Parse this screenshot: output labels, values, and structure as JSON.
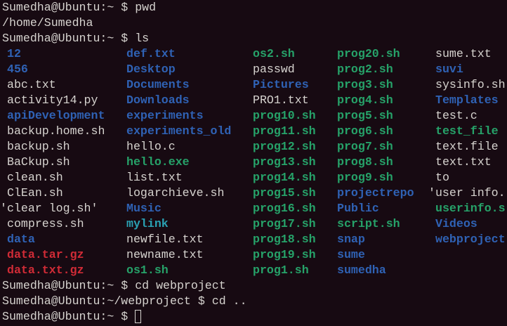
{
  "colors": {
    "background": "#170a12",
    "text": "#d6d3cf",
    "directory": "#2f62b5",
    "executable": "#26a269",
    "archive": "#d02b36",
    "symlink": "#2aa1b3"
  },
  "commands": [
    {
      "prompt": "Sumedha@Ubuntu:~ $ ",
      "command": "pwd"
    },
    {
      "output": "/home/Sumedha"
    },
    {
      "prompt": "Sumedha@Ubuntu:~ $ ",
      "command": "ls"
    }
  ],
  "ls_rows": [
    [
      {
        "t": "12",
        "k": "dir"
      },
      {
        "t": "def.txt",
        "k": "dir"
      },
      {
        "t": "os2.sh",
        "k": "exec"
      },
      {
        "t": "prog20.sh",
        "k": "exec"
      },
      {
        "t": "sume.txt",
        "k": "file"
      }
    ],
    [
      {
        "t": "456",
        "k": "dir"
      },
      {
        "t": "Desktop",
        "k": "dir"
      },
      {
        "t": "passwd",
        "k": "file"
      },
      {
        "t": "prog2.sh",
        "k": "exec"
      },
      {
        "t": "suvi",
        "k": "dir"
      }
    ],
    [
      {
        "t": "abc.txt",
        "k": "file"
      },
      {
        "t": "Documents",
        "k": "dir"
      },
      {
        "t": "Pictures",
        "k": "dir"
      },
      {
        "t": "prog3.sh",
        "k": "exec"
      },
      {
        "t": "sysinfo.sh",
        "k": "file"
      }
    ],
    [
      {
        "t": "activity14.py",
        "k": "file"
      },
      {
        "t": "Downloads",
        "k": "dir"
      },
      {
        "t": "PRO1.txt",
        "k": "file"
      },
      {
        "t": "prog4.sh",
        "k": "exec"
      },
      {
        "t": "Templates",
        "k": "dir"
      }
    ],
    [
      {
        "t": "apiDevelopment",
        "k": "dir"
      },
      {
        "t": "experiments",
        "k": "dir"
      },
      {
        "t": "prog10.sh",
        "k": "exec"
      },
      {
        "t": "prog5.sh",
        "k": "exec"
      },
      {
        "t": "test.c",
        "k": "file"
      }
    ],
    [
      {
        "t": "backup.home.sh",
        "k": "file"
      },
      {
        "t": "experiments_old",
        "k": "dir"
      },
      {
        "t": "prog11.sh",
        "k": "exec"
      },
      {
        "t": "prog6.sh",
        "k": "exec"
      },
      {
        "t": "test_file",
        "k": "exec"
      }
    ],
    [
      {
        "t": "backup.sh",
        "k": "file"
      },
      {
        "t": "hello.c",
        "k": "file"
      },
      {
        "t": "prog12.sh",
        "k": "exec"
      },
      {
        "t": "prog7.sh",
        "k": "exec"
      },
      {
        "t": "text.file",
        "k": "file"
      }
    ],
    [
      {
        "t": "BaCkup.sh",
        "k": "file"
      },
      {
        "t": "hello.exe",
        "k": "exec"
      },
      {
        "t": "prog13.sh",
        "k": "exec"
      },
      {
        "t": "prog8.sh",
        "k": "exec"
      },
      {
        "t": "text.txt",
        "k": "file"
      }
    ],
    [
      {
        "t": "clean.sh",
        "k": "file"
      },
      {
        "t": "list.txt",
        "k": "file"
      },
      {
        "t": "prog14.sh",
        "k": "exec"
      },
      {
        "t": "prog9.sh",
        "k": "exec"
      },
      {
        "t": "to",
        "k": "file"
      }
    ],
    [
      {
        "t": "ClEan.sh",
        "k": "file"
      },
      {
        "t": "logarchieve.sh",
        "k": "file"
      },
      {
        "t": "prog15.sh",
        "k": "exec"
      },
      {
        "t": "projectrepo",
        "k": "dir"
      },
      {
        "t": "'user info.",
        "k": "file",
        "q": 1
      }
    ],
    [
      {
        "t": "'clear log.sh'",
        "k": "file",
        "q": 1
      },
      {
        "t": "Music",
        "k": "dir"
      },
      {
        "t": "prog16.sh",
        "k": "exec"
      },
      {
        "t": "Public",
        "k": "dir"
      },
      {
        "t": "userinfo.s",
        "k": "exec"
      }
    ],
    [
      {
        "t": "compress.sh",
        "k": "file"
      },
      {
        "t": "mylink",
        "k": "link"
      },
      {
        "t": "prog17.sh",
        "k": "exec"
      },
      {
        "t": "script.sh",
        "k": "exec"
      },
      {
        "t": "Videos",
        "k": "dir"
      }
    ],
    [
      {
        "t": "data",
        "k": "dir"
      },
      {
        "t": "newfile.txt",
        "k": "file"
      },
      {
        "t": "prog18.sh",
        "k": "exec"
      },
      {
        "t": "snap",
        "k": "dir"
      },
      {
        "t": "webproject",
        "k": "dir"
      }
    ],
    [
      {
        "t": "data.tar.gz",
        "k": "archive"
      },
      {
        "t": "newname.txt",
        "k": "file"
      },
      {
        "t": "prog19.sh",
        "k": "exec"
      },
      {
        "t": "sume",
        "k": "dir"
      }
    ],
    [
      {
        "t": "data.txt.gz",
        "k": "archive"
      },
      {
        "t": "os1.sh",
        "k": "exec"
      },
      {
        "t": "prog1.sh",
        "k": "exec"
      },
      {
        "t": "sumedha",
        "k": "dir"
      }
    ]
  ],
  "after": [
    {
      "prompt": "Sumedha@Ubuntu:~ $ ",
      "command": "cd webproject"
    },
    {
      "prompt": "Sumedha@Ubuntu:~/webproject $ ",
      "command": "cd .."
    },
    {
      "prompt": "Sumedha@Ubuntu:~ $ ",
      "command": ""
    }
  ]
}
